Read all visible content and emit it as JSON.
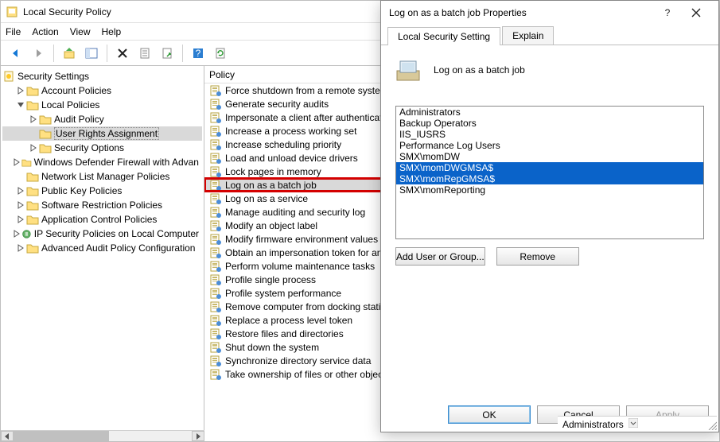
{
  "window": {
    "title": "Local Security Policy",
    "menu": {
      "file": "File",
      "action": "Action",
      "view": "View",
      "help": "Help"
    }
  },
  "tree": {
    "root": "Security Settings",
    "items": [
      {
        "label": "Account Policies",
        "depth": 1,
        "expander": "closed",
        "kind": "folder"
      },
      {
        "label": "Local Policies",
        "depth": 1,
        "expander": "open",
        "kind": "folder"
      },
      {
        "label": "Audit Policy",
        "depth": 2,
        "expander": "closed",
        "kind": "folder"
      },
      {
        "label": "User Rights Assignment",
        "depth": 2,
        "expander": "none",
        "kind": "folder",
        "selected": true
      },
      {
        "label": "Security Options",
        "depth": 2,
        "expander": "closed",
        "kind": "folder"
      },
      {
        "label": "Windows Defender Firewall with Advan",
        "depth": 1,
        "expander": "closed",
        "kind": "folder"
      },
      {
        "label": "Network List Manager Policies",
        "depth": 1,
        "expander": "none",
        "kind": "folder"
      },
      {
        "label": "Public Key Policies",
        "depth": 1,
        "expander": "closed",
        "kind": "folder"
      },
      {
        "label": "Software Restriction Policies",
        "depth": 1,
        "expander": "closed",
        "kind": "folder"
      },
      {
        "label": "Application Control Policies",
        "depth": 1,
        "expander": "closed",
        "kind": "folder"
      },
      {
        "label": "IP Security Policies on Local Computer",
        "depth": 1,
        "expander": "closed",
        "kind": "ipsec"
      },
      {
        "label": "Advanced Audit Policy Configuration",
        "depth": 1,
        "expander": "closed",
        "kind": "folder"
      }
    ]
  },
  "list": {
    "header": "Policy",
    "items": [
      {
        "label": "Force shutdown from a remote system"
      },
      {
        "label": "Generate security audits"
      },
      {
        "label": "Impersonate a client after authenticati"
      },
      {
        "label": "Increase a process working set"
      },
      {
        "label": "Increase scheduling priority"
      },
      {
        "label": "Load and unload device drivers"
      },
      {
        "label": "Lock pages in memory"
      },
      {
        "label": "Log on as a batch job",
        "selected": true,
        "highlighted": true
      },
      {
        "label": "Log on as a service"
      },
      {
        "label": "Manage auditing and security log"
      },
      {
        "label": "Modify an object label"
      },
      {
        "label": "Modify firmware environment values"
      },
      {
        "label": "Obtain an impersonation token for an"
      },
      {
        "label": "Perform volume maintenance tasks"
      },
      {
        "label": "Profile single process"
      },
      {
        "label": "Profile system performance"
      },
      {
        "label": "Remove computer from docking stati"
      },
      {
        "label": "Replace a process level token"
      },
      {
        "label": "Restore files and directories"
      },
      {
        "label": "Shut down the system"
      },
      {
        "label": "Synchronize directory service data"
      },
      {
        "label": "Take ownership of files or other objects"
      }
    ]
  },
  "dialog": {
    "title": "Log on as a batch job Properties",
    "tabs": {
      "local": "Local Security Setting",
      "explain": "Explain"
    },
    "policy_name": "Log on as a batch job",
    "users": [
      {
        "name": "Administrators",
        "selected": false
      },
      {
        "name": "Backup Operators",
        "selected": false
      },
      {
        "name": "IIS_IUSRS",
        "selected": false
      },
      {
        "name": "Performance Log Users",
        "selected": false
      },
      {
        "name": "SMX\\momDW",
        "selected": false
      },
      {
        "name": "SMX\\momDWGMSA$",
        "selected": true
      },
      {
        "name": "SMX\\momRepGMSA$",
        "selected": true
      },
      {
        "name": "SMX\\momReporting",
        "selected": false
      }
    ],
    "buttons": {
      "add": "Add User or Group...",
      "remove": "Remove",
      "ok": "OK",
      "cancel": "Cancel",
      "apply": "Apply"
    }
  },
  "status": {
    "right_label": "Administrators"
  }
}
